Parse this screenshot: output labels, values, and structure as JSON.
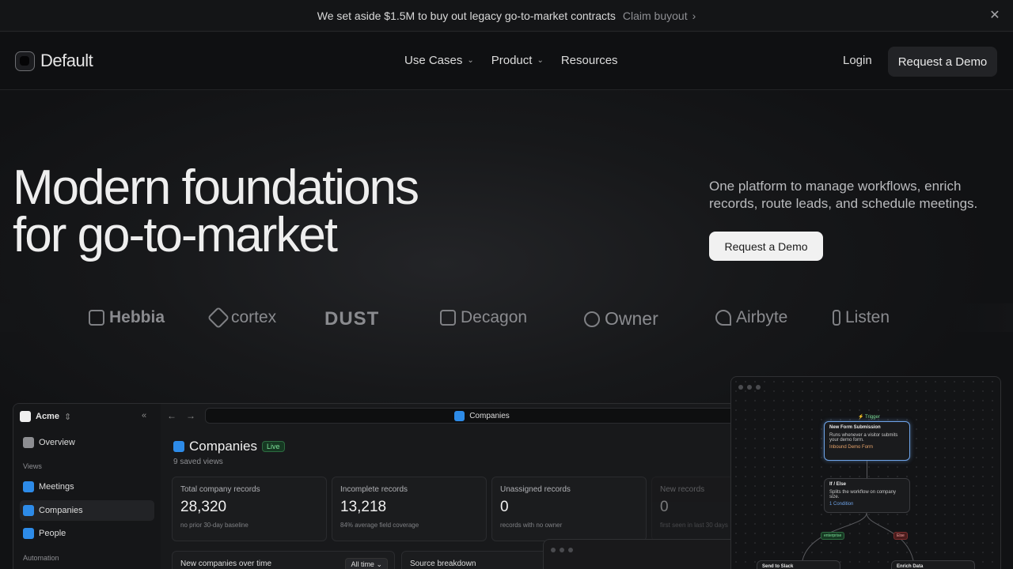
{
  "announcement": {
    "message": "We set aside $1.5M to buy out legacy go-to-market contracts",
    "link": "Claim buyout",
    "link_icon": "chevron-right-icon",
    "close_icon": "close-icon"
  },
  "nav": {
    "brand": "Default",
    "menu": [
      {
        "label": "Use Cases",
        "has_dropdown": true
      },
      {
        "label": "Product",
        "has_dropdown": true
      },
      {
        "label": "Resources",
        "has_dropdown": false
      }
    ],
    "login": "Login",
    "cta": "Request a Demo"
  },
  "hero": {
    "headline_line1": "Modern foundations",
    "headline_line2": "for go-to-market",
    "subtitle": "One platform to manage workflows, enrich records, route leads, and schedule meetings.",
    "cta": "Request a Demo"
  },
  "customer_logos": [
    "Hebbia",
    "cortex",
    "DUST",
    "Decagon",
    "Owner",
    "Airbyte",
    "Listen"
  ],
  "app": {
    "workspace": "Acme",
    "sidebar": {
      "overview": "Overview",
      "views_heading": "Views",
      "items": [
        "Meetings",
        "Companies",
        "People"
      ],
      "automation_heading": "Automation"
    },
    "address": "Companies",
    "page_title": "Companies",
    "badge": "Live",
    "saved_views": "9 saved views",
    "stats": [
      {
        "label": "Total company records",
        "value": "28,320",
        "caption": "no prior 30-day baseline"
      },
      {
        "label": "Incomplete records",
        "value": "13,218",
        "caption": "84% average field coverage"
      },
      {
        "label": "Unassigned records",
        "value": "0",
        "caption": "records with no owner"
      },
      {
        "label": "New records",
        "value": "0",
        "caption": "first seen in last 30 days"
      }
    ],
    "panels": {
      "chart_title": "New companies over time",
      "range": "All time",
      "breakdown_title": "Source breakdown"
    }
  },
  "workflow": {
    "trigger": "Trigger",
    "node1_title": "New Form Submission",
    "node1_desc": "Runs whenever a visitor submits your demo form.",
    "node1_tag": "Inbound Demo Form",
    "node2_title": "If / Else",
    "node2_desc": "Splits the workflow on company size.",
    "node2_tag": "1 Condition",
    "branch_yes": "enterprise",
    "branch_no": "Else",
    "node3_title": "Send to Slack",
    "node4_title": "Enrich Data"
  },
  "colors": {
    "accent": "#2d8be8",
    "live": "#7ee09a",
    "background": "#111214"
  }
}
